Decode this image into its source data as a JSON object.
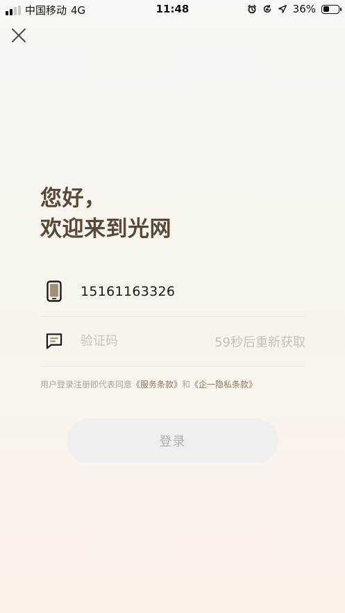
{
  "status_bar": {
    "carrier": "中国移动",
    "network": "4G",
    "time": "11:48",
    "battery": "36%",
    "battery_level": 0.36,
    "icons": [
      "signal-icon",
      "alarm-icon",
      "rotation-lock-icon",
      "location-arrow-icon",
      "battery-icon"
    ]
  },
  "close_icon": "close-icon",
  "greeting": {
    "line1": "您好，",
    "line2": "欢迎来到光网"
  },
  "phone": {
    "icon": "phone-icon",
    "value": "15161163326"
  },
  "code": {
    "icon": "message-icon",
    "placeholder": "验证码",
    "resend": "59秒后重新获取"
  },
  "agreement": {
    "prefix": "用户登录注册即代表同意",
    "service_link": "《服务条款》",
    "and": "和",
    "privacy_link": "《企一隐私条款》"
  },
  "login": {
    "label": "登录"
  },
  "colors": {
    "title": "#5a4738",
    "link": "#8b7760",
    "muted": "#c6c0b8",
    "button_bg": "#efefef",
    "button_text": "#b1aca6"
  }
}
